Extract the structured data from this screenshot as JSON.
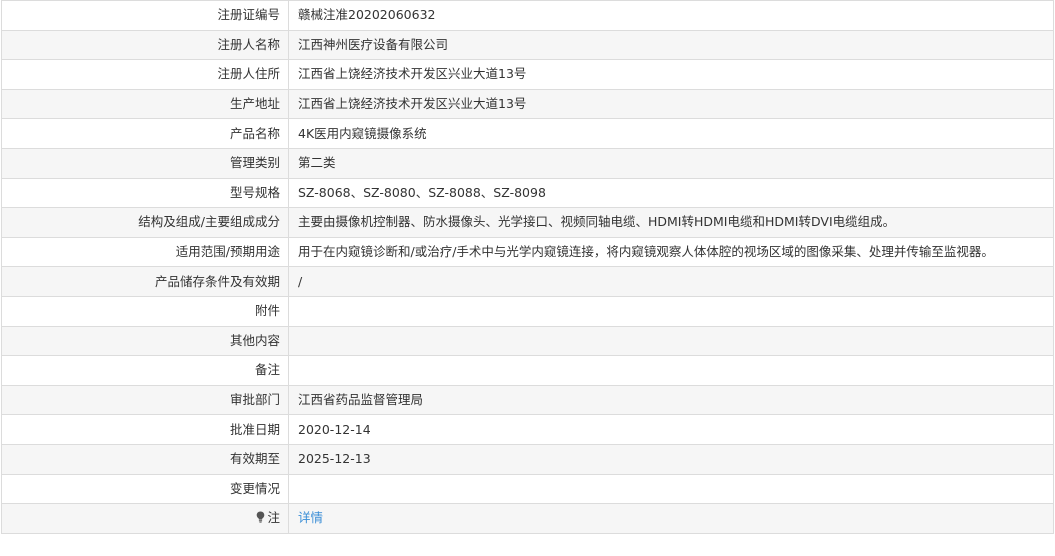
{
  "rows": [
    {
      "label": "注册证编号",
      "value": "赣械注准20202060632"
    },
    {
      "label": "注册人名称",
      "value": "江西神州医疗设备有限公司"
    },
    {
      "label": "注册人住所",
      "value": "江西省上饶经济技术开发区兴业大道13号"
    },
    {
      "label": "生产地址",
      "value": "江西省上饶经济技术开发区兴业大道13号"
    },
    {
      "label": "产品名称",
      "value": "4K医用内窥镜摄像系统"
    },
    {
      "label": "管理类别",
      "value": "第二类"
    },
    {
      "label": "型号规格",
      "value": "SZ-8068、SZ-8080、SZ-8088、SZ-8098"
    },
    {
      "label": "结构及组成/主要组成成分",
      "value": "主要由摄像机控制器、防水摄像头、光学接口、视频同轴电缆、HDMI转HDMI电缆和HDMI转DVI电缆组成。"
    },
    {
      "label": "适用范围/预期用途",
      "value": "用于在内窥镜诊断和/或治疗/手术中与光学内窥镜连接，将内窥镜观察人体体腔的视场区域的图像采集、处理并传输至监视器。"
    },
    {
      "label": "产品储存条件及有效期",
      "value": "/"
    },
    {
      "label": "附件",
      "value": ""
    },
    {
      "label": "其他内容",
      "value": ""
    },
    {
      "label": "备注",
      "value": ""
    },
    {
      "label": "审批部门",
      "value": "江西省药品监督管理局"
    },
    {
      "label": "批准日期",
      "value": "2020-12-14"
    },
    {
      "label": "有效期至",
      "value": "2025-12-13"
    },
    {
      "label": "变更情况",
      "value": ""
    }
  ],
  "note": {
    "icon": "lightbulb-icon",
    "label": "注",
    "link_text": "详情"
  }
}
